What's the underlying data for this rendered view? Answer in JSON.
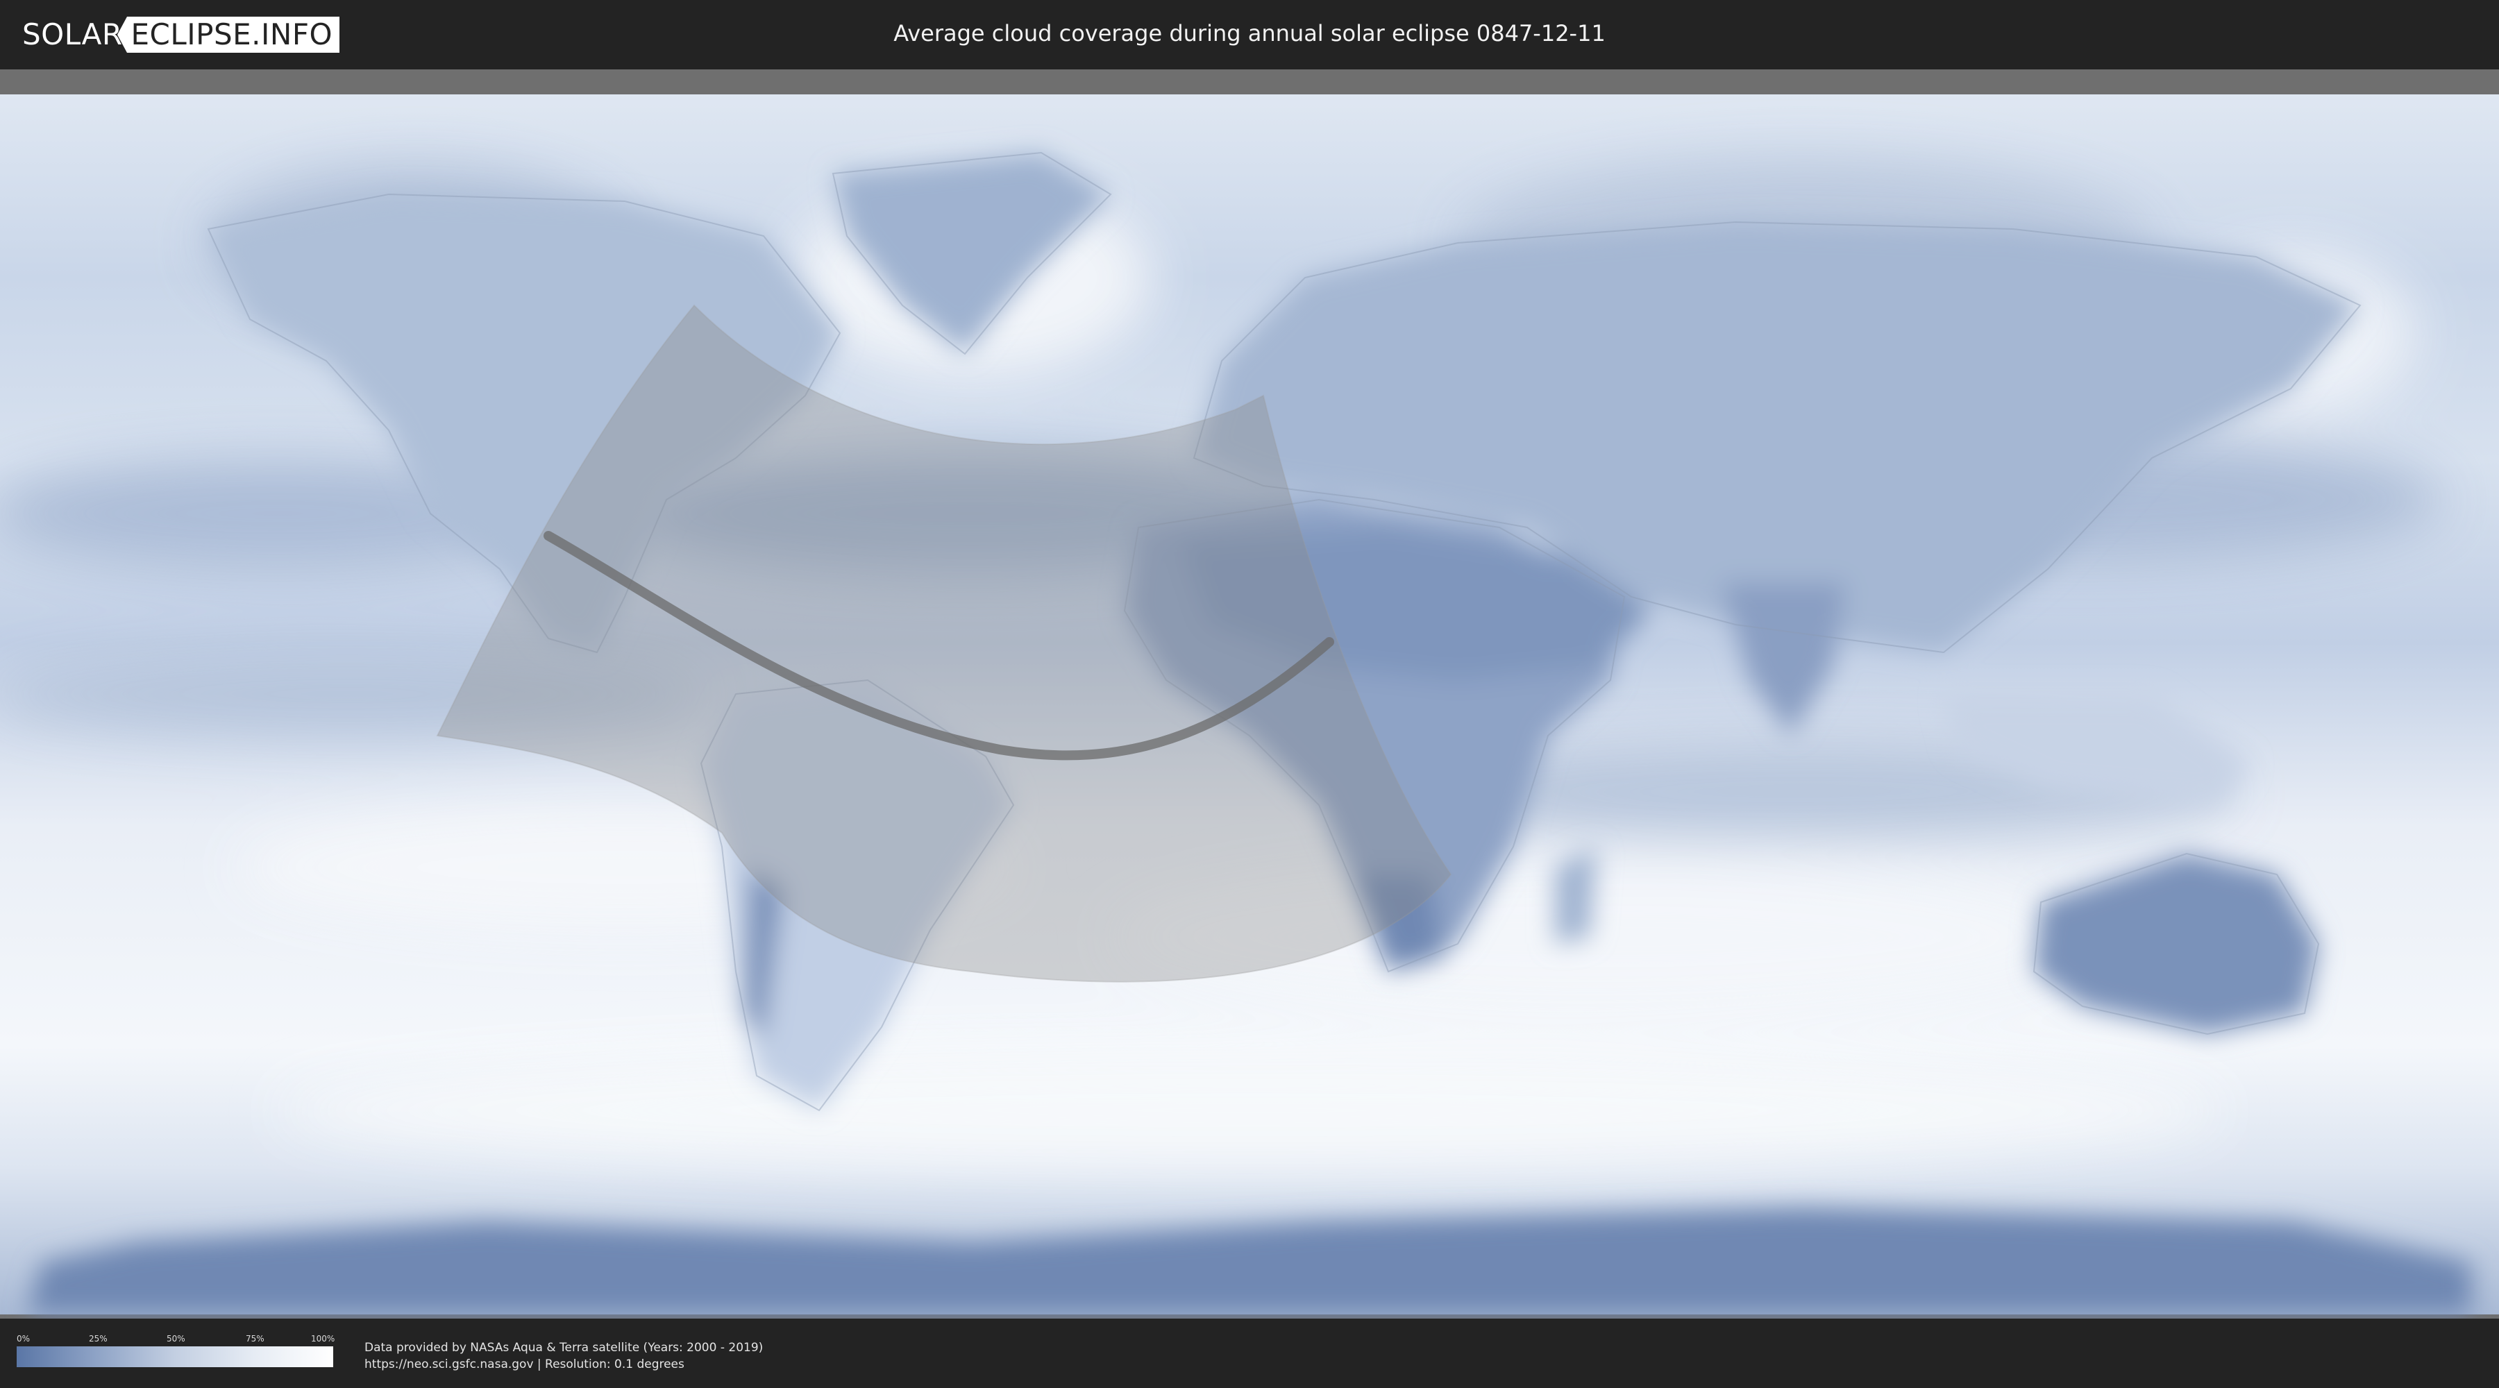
{
  "header": {
    "logo": {
      "part_a": "SOLAR",
      "part_b": "ECLIPSE.INFO"
    },
    "title": "Average cloud coverage during annual solar eclipse 0847-12-11"
  },
  "map": {
    "projection": "equirectangular",
    "palette": {
      "ocean_cloud_high": "#f4f7fb",
      "cloud_low": "#5f7cab",
      "cloud_mid": "#a9bad5",
      "eclipse_zone_fill": "#8a8a8a",
      "central_line": "#6b6b6b"
    }
  },
  "legend": {
    "ticks": [
      "0%",
      "25%",
      "50%",
      "75%",
      "100%"
    ]
  },
  "credits": {
    "line1": "Data provided by NASAs Aqua & Terra satellite (Years: 2000 - 2019)",
    "line2": "https://neo.sci.gsfc.nasa.gov | Resolution: 0.1 degrees"
  }
}
